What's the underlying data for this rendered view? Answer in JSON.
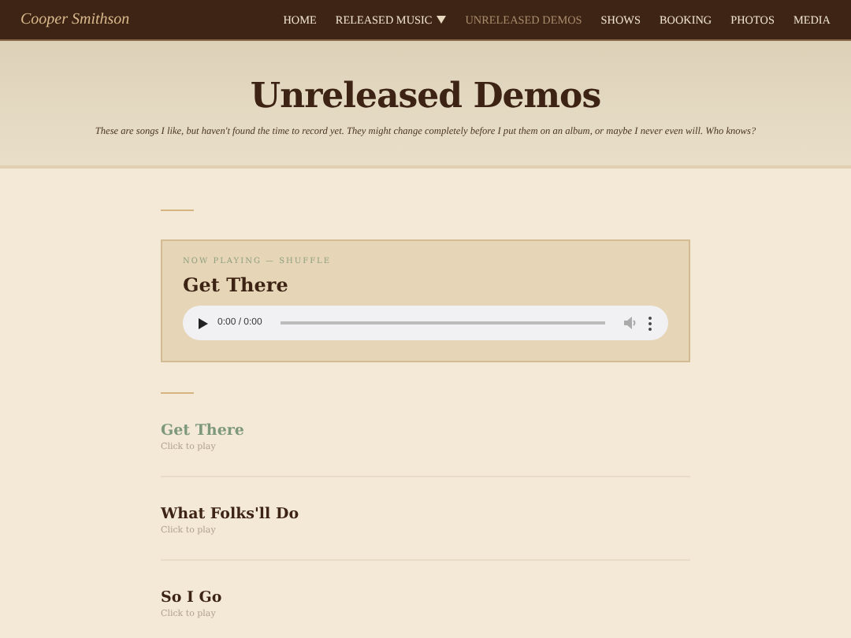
{
  "site_title": "Cooper Smithson",
  "nav": [
    {
      "label": "HOME",
      "selected": false,
      "has_menu": false
    },
    {
      "label": "RELEASED MUSIC",
      "selected": false,
      "has_menu": true
    },
    {
      "label": "UNRELEASED DEMOS",
      "selected": true,
      "has_menu": false
    },
    {
      "label": "SHOWS",
      "selected": false,
      "has_menu": false
    },
    {
      "label": "BOOKING",
      "selected": false,
      "has_menu": false
    },
    {
      "label": "PHOTOS",
      "selected": false,
      "has_menu": false
    },
    {
      "label": "MEDIA",
      "selected": false,
      "has_menu": false
    }
  ],
  "page_title": "Unreleased Demos",
  "intro": "These are songs I like, but haven't found the time to record yet. They might change completely before I put them on an album, or maybe I never even will. Who knows?",
  "now_playing": {
    "label": "NOW PLAYING — SHUFFLE",
    "title": "Get There",
    "time": "0:00 / 0:00"
  },
  "songs": [
    {
      "title": "Get There",
      "hint": "Click to play",
      "selected": true
    },
    {
      "title": "What Folks'll Do",
      "hint": "Click to play",
      "selected": false
    },
    {
      "title": "So I Go",
      "hint": "Click to play",
      "selected": false
    }
  ]
}
